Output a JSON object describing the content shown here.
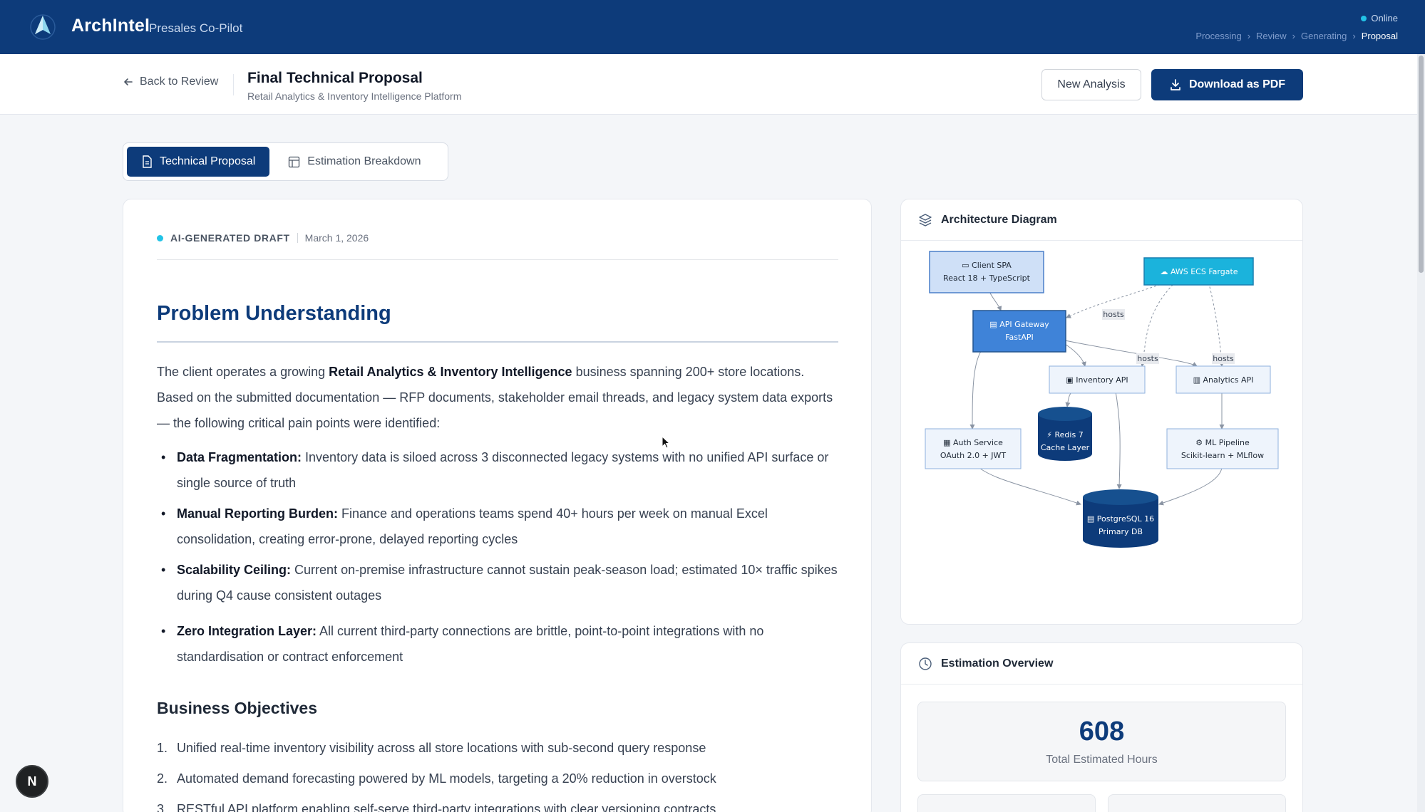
{
  "header": {
    "brand": "ArchIntel",
    "subtitle": "Presales Co-Pilot",
    "status": "Online",
    "breadcrumbs": [
      "Processing",
      "Review",
      "Generating",
      "Proposal"
    ]
  },
  "subheader": {
    "back_label": "Back to Review",
    "title": "Final Technical Proposal",
    "subtitle": "Retail Analytics & Inventory Intelligence Platform",
    "new_analysis": "New Analysis",
    "download_pdf": "Download as PDF"
  },
  "tabs": [
    {
      "label": "Technical Proposal",
      "active": true
    },
    {
      "label": "Estimation Breakdown",
      "active": false
    }
  ],
  "document": {
    "badge": "AI-GENERATED DRAFT",
    "date": "March 1, 2026",
    "heading": "Problem Understanding",
    "intro_pre": "The client operates a growing ",
    "intro_bold": "Retail Analytics & Inventory Intelligence",
    "intro_post": " business spanning 200+ store locations. Based on the submitted documentation — RFP documents, stakeholder email threads, and legacy system data exports — the following critical pain points were identified:",
    "pain_points": [
      {
        "title": "Data Fragmentation:",
        "text": " Inventory data is siloed across 3 disconnected legacy systems with no unified API surface or single source of truth"
      },
      {
        "title": "Manual Reporting Burden:",
        "text": " Finance and operations teams spend 40+ hours per week on manual Excel consolidation, creating error-prone, delayed reporting cycles"
      },
      {
        "title": "Scalability Ceiling:",
        "text": " Current on-premise infrastructure cannot sustain peak-season load; estimated 10× traffic spikes during Q4 cause consistent outages"
      },
      {
        "title": "Zero Integration Layer:",
        "text": " All current third-party connections are brittle, point-to-point integrations with no standardisation or contract enforcement"
      }
    ],
    "objectives_heading": "Business Objectives",
    "objectives": [
      {
        "num": "1.",
        "text": "Unified real-time inventory visibility across all store locations with sub-second query response"
      },
      {
        "num": "2.",
        "text": "Automated demand forecasting powered by ML models, targeting a 20% reduction in overstock"
      },
      {
        "num": "3.",
        "text": "RESTful API platform enabling self-serve third-party integrations with clear versioning contracts"
      }
    ]
  },
  "architecture": {
    "title": "Architecture Diagram",
    "nodes": {
      "client": [
        "Client SPA",
        "React 18 + TypeScript"
      ],
      "ecs": "AWS ECS Fargate",
      "gateway": [
        "API Gateway",
        "FastAPI"
      ],
      "inventory": "Inventory API",
      "analytics": "Analytics API",
      "auth": [
        "Auth Service",
        "OAuth 2.0 + JWT"
      ],
      "redis": [
        "Redis 7",
        "Cache Layer"
      ],
      "ml": [
        "ML Pipeline",
        "Scikit-learn + MLflow"
      ],
      "postgres": [
        "PostgreSQL 16",
        "Primary DB"
      ]
    },
    "edge_label": "hosts"
  },
  "estimation": {
    "title": "Estimation Overview",
    "total_hours": "608",
    "total_label": "Total Estimated Hours"
  },
  "badge": "N"
}
